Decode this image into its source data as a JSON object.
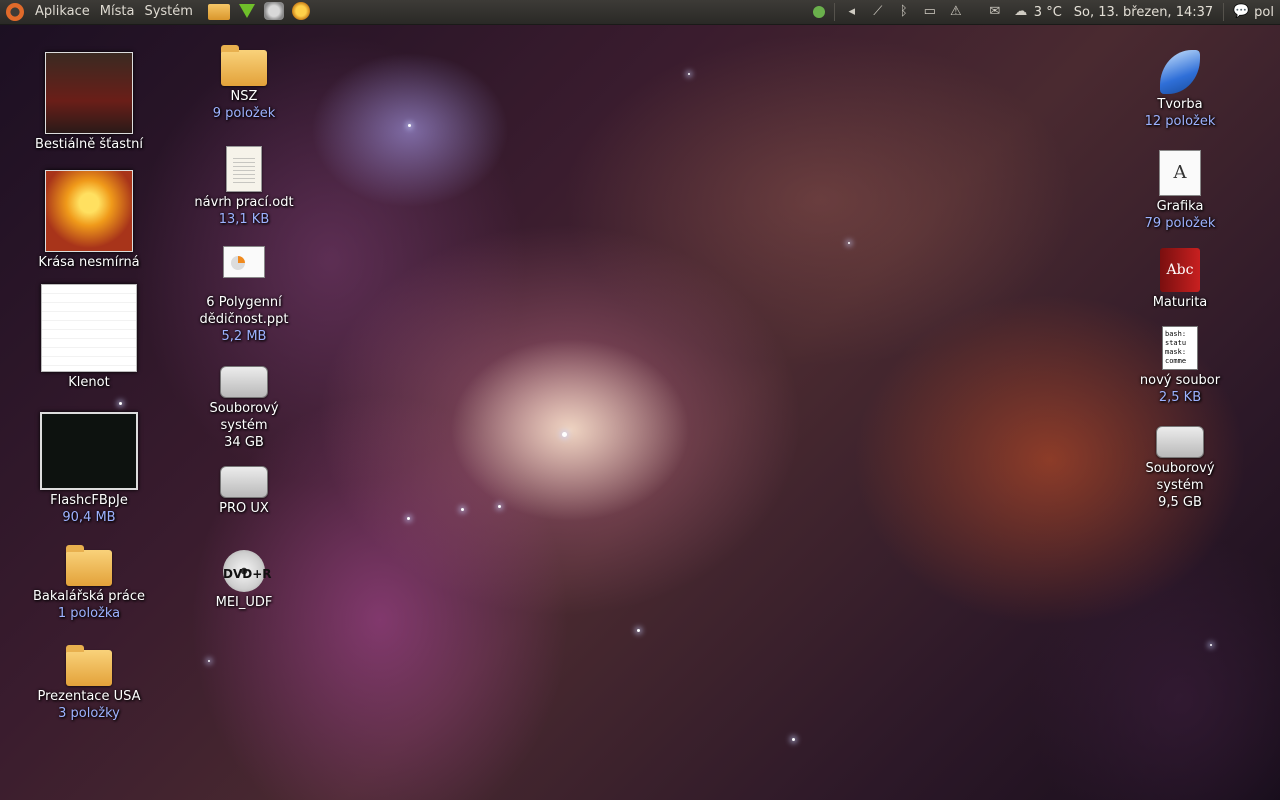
{
  "panel": {
    "menus": [
      "Aplikace",
      "Místa",
      "Systém"
    ],
    "temperature": "3 °C",
    "datetime": "So, 13. březen, 14:37",
    "user": "pol"
  },
  "desktop": {
    "left_column": [
      {
        "label": "Bestiálně šťastní",
        "sub": ""
      },
      {
        "label": "Krása nesmírná",
        "sub": ""
      },
      {
        "label": "Klenot",
        "sub": ""
      },
      {
        "label": "FlashcFBpJe",
        "sub": "90,4 MB"
      },
      {
        "label": "Bakalářská práce",
        "sub": "1 položka"
      },
      {
        "label": "Prezentace USA",
        "sub": "3 položky"
      }
    ],
    "second_column": [
      {
        "label": "NSZ",
        "sub": "9 položek"
      },
      {
        "label": "návrh prací.odt",
        "sub": "13,1 KB"
      },
      {
        "label": "6 Polygenní dědičnost.ppt",
        "sub": "5,2 MB"
      },
      {
        "label": "Souborový systém",
        "sub": "34 GB"
      },
      {
        "label": "PRO UX",
        "sub": ""
      },
      {
        "label": "MEI_UDF",
        "sub": ""
      }
    ],
    "right_column": [
      {
        "label": "Tvorba",
        "sub": "12 položek"
      },
      {
        "label": "Grafika",
        "sub": "79 položek"
      },
      {
        "label": "Maturita",
        "sub": ""
      },
      {
        "label": "nový soubor",
        "sub": "2,5 KB",
        "preview": "bash:\nstatu\nmask:\ncomme"
      },
      {
        "label": "Souborový systém",
        "sub": "9,5 GB"
      }
    ],
    "glyphs": {
      "dvd": "DVD+R",
      "fonts": "A",
      "abc": "Abc"
    }
  }
}
